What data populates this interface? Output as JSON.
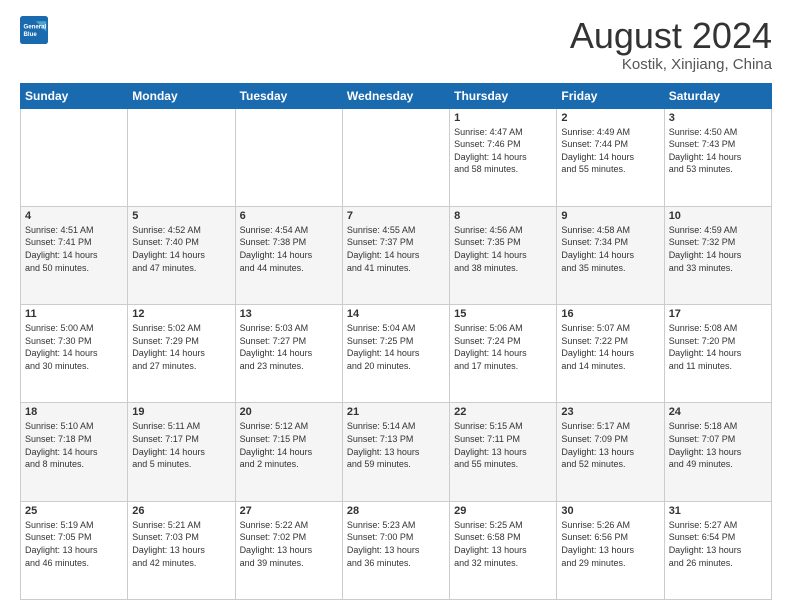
{
  "header": {
    "logo_line1": "General",
    "logo_line2": "Blue",
    "month_title": "August 2024",
    "location": "Kostik, Xinjiang, China"
  },
  "weekdays": [
    "Sunday",
    "Monday",
    "Tuesday",
    "Wednesday",
    "Thursday",
    "Friday",
    "Saturday"
  ],
  "weeks": [
    [
      {
        "day": "",
        "info": ""
      },
      {
        "day": "",
        "info": ""
      },
      {
        "day": "",
        "info": ""
      },
      {
        "day": "",
        "info": ""
      },
      {
        "day": "1",
        "info": "Sunrise: 4:47 AM\nSunset: 7:46 PM\nDaylight: 14 hours\nand 58 minutes."
      },
      {
        "day": "2",
        "info": "Sunrise: 4:49 AM\nSunset: 7:44 PM\nDaylight: 14 hours\nand 55 minutes."
      },
      {
        "day": "3",
        "info": "Sunrise: 4:50 AM\nSunset: 7:43 PM\nDaylight: 14 hours\nand 53 minutes."
      }
    ],
    [
      {
        "day": "4",
        "info": "Sunrise: 4:51 AM\nSunset: 7:41 PM\nDaylight: 14 hours\nand 50 minutes."
      },
      {
        "day": "5",
        "info": "Sunrise: 4:52 AM\nSunset: 7:40 PM\nDaylight: 14 hours\nand 47 minutes."
      },
      {
        "day": "6",
        "info": "Sunrise: 4:54 AM\nSunset: 7:38 PM\nDaylight: 14 hours\nand 44 minutes."
      },
      {
        "day": "7",
        "info": "Sunrise: 4:55 AM\nSunset: 7:37 PM\nDaylight: 14 hours\nand 41 minutes."
      },
      {
        "day": "8",
        "info": "Sunrise: 4:56 AM\nSunset: 7:35 PM\nDaylight: 14 hours\nand 38 minutes."
      },
      {
        "day": "9",
        "info": "Sunrise: 4:58 AM\nSunset: 7:34 PM\nDaylight: 14 hours\nand 35 minutes."
      },
      {
        "day": "10",
        "info": "Sunrise: 4:59 AM\nSunset: 7:32 PM\nDaylight: 14 hours\nand 33 minutes."
      }
    ],
    [
      {
        "day": "11",
        "info": "Sunrise: 5:00 AM\nSunset: 7:30 PM\nDaylight: 14 hours\nand 30 minutes."
      },
      {
        "day": "12",
        "info": "Sunrise: 5:02 AM\nSunset: 7:29 PM\nDaylight: 14 hours\nand 27 minutes."
      },
      {
        "day": "13",
        "info": "Sunrise: 5:03 AM\nSunset: 7:27 PM\nDaylight: 14 hours\nand 23 minutes."
      },
      {
        "day": "14",
        "info": "Sunrise: 5:04 AM\nSunset: 7:25 PM\nDaylight: 14 hours\nand 20 minutes."
      },
      {
        "day": "15",
        "info": "Sunrise: 5:06 AM\nSunset: 7:24 PM\nDaylight: 14 hours\nand 17 minutes."
      },
      {
        "day": "16",
        "info": "Sunrise: 5:07 AM\nSunset: 7:22 PM\nDaylight: 14 hours\nand 14 minutes."
      },
      {
        "day": "17",
        "info": "Sunrise: 5:08 AM\nSunset: 7:20 PM\nDaylight: 14 hours\nand 11 minutes."
      }
    ],
    [
      {
        "day": "18",
        "info": "Sunrise: 5:10 AM\nSunset: 7:18 PM\nDaylight: 14 hours\nand 8 minutes."
      },
      {
        "day": "19",
        "info": "Sunrise: 5:11 AM\nSunset: 7:17 PM\nDaylight: 14 hours\nand 5 minutes."
      },
      {
        "day": "20",
        "info": "Sunrise: 5:12 AM\nSunset: 7:15 PM\nDaylight: 14 hours\nand 2 minutes."
      },
      {
        "day": "21",
        "info": "Sunrise: 5:14 AM\nSunset: 7:13 PM\nDaylight: 13 hours\nand 59 minutes."
      },
      {
        "day": "22",
        "info": "Sunrise: 5:15 AM\nSunset: 7:11 PM\nDaylight: 13 hours\nand 55 minutes."
      },
      {
        "day": "23",
        "info": "Sunrise: 5:17 AM\nSunset: 7:09 PM\nDaylight: 13 hours\nand 52 minutes."
      },
      {
        "day": "24",
        "info": "Sunrise: 5:18 AM\nSunset: 7:07 PM\nDaylight: 13 hours\nand 49 minutes."
      }
    ],
    [
      {
        "day": "25",
        "info": "Sunrise: 5:19 AM\nSunset: 7:05 PM\nDaylight: 13 hours\nand 46 minutes."
      },
      {
        "day": "26",
        "info": "Sunrise: 5:21 AM\nSunset: 7:03 PM\nDaylight: 13 hours\nand 42 minutes."
      },
      {
        "day": "27",
        "info": "Sunrise: 5:22 AM\nSunset: 7:02 PM\nDaylight: 13 hours\nand 39 minutes."
      },
      {
        "day": "28",
        "info": "Sunrise: 5:23 AM\nSunset: 7:00 PM\nDaylight: 13 hours\nand 36 minutes."
      },
      {
        "day": "29",
        "info": "Sunrise: 5:25 AM\nSunset: 6:58 PM\nDaylight: 13 hours\nand 32 minutes."
      },
      {
        "day": "30",
        "info": "Sunrise: 5:26 AM\nSunset: 6:56 PM\nDaylight: 13 hours\nand 29 minutes."
      },
      {
        "day": "31",
        "info": "Sunrise: 5:27 AM\nSunset: 6:54 PM\nDaylight: 13 hours\nand 26 minutes."
      }
    ]
  ]
}
